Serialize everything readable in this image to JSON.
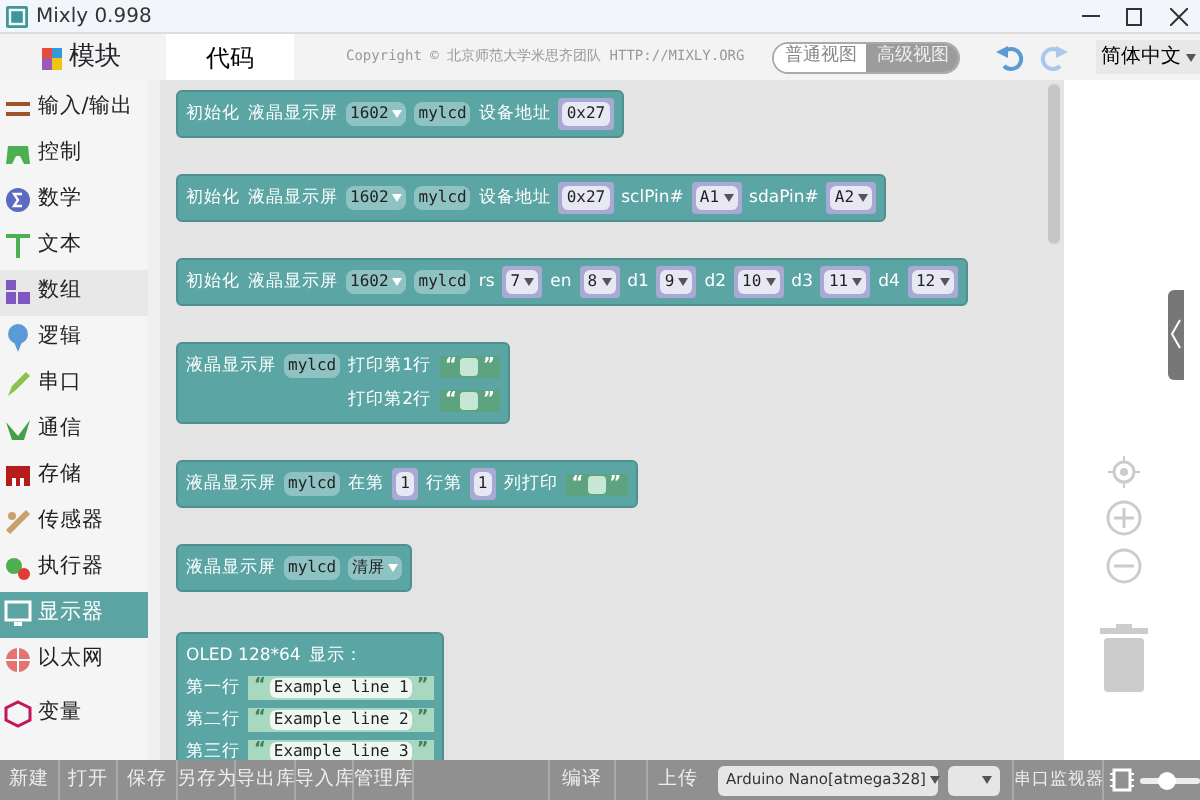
{
  "window": {
    "title": "Mixly 0.998"
  },
  "sidebar": {
    "header": "模块",
    "items": [
      {
        "label": "输入/输出",
        "selected": false,
        "hover": false
      },
      {
        "label": "控制",
        "selected": false,
        "hover": false
      },
      {
        "label": "数学",
        "selected": false,
        "hover": false
      },
      {
        "label": "文本",
        "selected": false,
        "hover": false
      },
      {
        "label": "数组",
        "selected": false,
        "hover": true
      },
      {
        "label": "逻辑",
        "selected": false,
        "hover": false
      },
      {
        "label": "串口",
        "selected": false,
        "hover": false
      },
      {
        "label": "通信",
        "selected": false,
        "hover": false
      },
      {
        "label": "存储",
        "selected": false,
        "hover": false
      },
      {
        "label": "传感器",
        "selected": false,
        "hover": false
      },
      {
        "label": "执行器",
        "selected": false,
        "hover": false
      },
      {
        "label": "显示器",
        "selected": true,
        "hover": false
      },
      {
        "label": "以太网",
        "selected": false,
        "hover": false
      },
      {
        "label": "变量",
        "selected": false,
        "hover": false
      }
    ]
  },
  "tabs": [
    {
      "label": "代码",
      "selected": true
    }
  ],
  "copyright": "Copyright © 北京师范大学米思齐团队 HTTP://MIXLY.ORG",
  "view_toggle": [
    {
      "label": "普通视图",
      "selected": false
    },
    {
      "label": "高级视图",
      "selected": true
    }
  ],
  "language": "简体中文",
  "blocks": [
    {
      "rows": [
        {
          "parts": [
            {
              "kind": "text",
              "text": "初始化"
            },
            {
              "kind": "text",
              "text": "液晶显示屏"
            },
            {
              "kind": "field",
              "text": "1602",
              "dropdown": true
            },
            {
              "kind": "field",
              "text": "mylcd",
              "dropdown": false
            },
            {
              "kind": "text",
              "text": "设备地址"
            },
            {
              "kind": "socket",
              "text": "0x27",
              "dropdown": false
            }
          ]
        }
      ]
    },
    {
      "rows": [
        {
          "parts": [
            {
              "kind": "text",
              "text": "初始化"
            },
            {
              "kind": "text",
              "text": "液晶显示屏"
            },
            {
              "kind": "field",
              "text": "1602",
              "dropdown": true
            },
            {
              "kind": "field",
              "text": "mylcd",
              "dropdown": false
            },
            {
              "kind": "text",
              "text": "设备地址"
            },
            {
              "kind": "socket",
              "text": "0x27",
              "dropdown": false
            },
            {
              "kind": "text",
              "text": "sclPin#"
            },
            {
              "kind": "socket",
              "text": "A1",
              "dropdown": true
            },
            {
              "kind": "text",
              "text": "sdaPin#"
            },
            {
              "kind": "socket",
              "text": "A2",
              "dropdown": true
            }
          ]
        }
      ]
    },
    {
      "rows": [
        {
          "parts": [
            {
              "kind": "text",
              "text": "初始化"
            },
            {
              "kind": "text",
              "text": "液晶显示屏"
            },
            {
              "kind": "field",
              "text": "1602",
              "dropdown": true
            },
            {
              "kind": "field",
              "text": "mylcd",
              "dropdown": false
            },
            {
              "kind": "text",
              "text": "rs"
            },
            {
              "kind": "socket",
              "text": "7",
              "dropdown": true
            },
            {
              "kind": "text",
              "text": "en"
            },
            {
              "kind": "socket",
              "text": "8",
              "dropdown": true
            },
            {
              "kind": "text",
              "text": "d1"
            },
            {
              "kind": "socket",
              "text": "9",
              "dropdown": true
            },
            {
              "kind": "text",
              "text": "d2"
            },
            {
              "kind": "socket",
              "text": "10",
              "dropdown": true
            },
            {
              "kind": "text",
              "text": "d3"
            },
            {
              "kind": "socket",
              "text": "11",
              "dropdown": true
            },
            {
              "kind": "text",
              "text": "d4"
            },
            {
              "kind": "socket",
              "text": "12",
              "dropdown": true
            }
          ]
        }
      ]
    },
    {
      "rows": [
        {
          "parts": [
            {
              "kind": "text",
              "text": "液晶显示屏"
            },
            {
              "kind": "field",
              "text": "mylcd",
              "dropdown": false
            },
            {
              "kind": "text",
              "text": "打印第1行"
            },
            {
              "kind": "string",
              "open": "“",
              "close": "”"
            }
          ]
        },
        {
          "parts": [
            {
              "kind": "text",
              "text": "打印第2行"
            },
            {
              "kind": "string",
              "open": "“",
              "close": "”"
            }
          ]
        }
      ]
    },
    {
      "rows": [
        {
          "parts": [
            {
              "kind": "text",
              "text": "液晶显示屏"
            },
            {
              "kind": "field",
              "text": "mylcd",
              "dropdown": false
            },
            {
              "kind": "text",
              "text": "在第"
            },
            {
              "kind": "socket",
              "text": "1",
              "dropdown": false
            },
            {
              "kind": "text",
              "text": "行第"
            },
            {
              "kind": "socket",
              "text": "1",
              "dropdown": false
            },
            {
              "kind": "text",
              "text": "列打印"
            },
            {
              "kind": "string",
              "open": "“",
              "close": "”"
            }
          ]
        }
      ]
    },
    {
      "rows": [
        {
          "parts": [
            {
              "kind": "text",
              "text": "液晶显示屏"
            },
            {
              "kind": "field",
              "text": "mylcd",
              "dropdown": false
            },
            {
              "kind": "field",
              "text": "清屏",
              "dropdown": true
            }
          ]
        }
      ]
    },
    {
      "rows": [
        {
          "parts": [
            {
              "kind": "text",
              "text": "OLED 128*64"
            },
            {
              "kind": "text",
              "text": "显示："
            }
          ]
        },
        {
          "parts": [
            {
              "kind": "text",
              "text": "第一行"
            },
            {
              "kind": "string",
              "open": "“",
              "text": "Example line 1",
              "close": "”"
            }
          ]
        },
        {
          "parts": [
            {
              "kind": "text",
              "text": "第二行"
            },
            {
              "kind": "string",
              "open": "“",
              "text": "Example line 2",
              "close": "”"
            }
          ]
        },
        {
          "parts": [
            {
              "kind": "text",
              "text": "第三行"
            },
            {
              "kind": "string",
              "open": "“",
              "text": "Example line 3",
              "close": "”"
            }
          ]
        }
      ]
    }
  ],
  "toolbar": {
    "buttons": [
      "新建",
      "打开",
      "保存",
      "另存为",
      "导出库",
      "导入库",
      "管理库"
    ],
    "compile": "编译",
    "upload": "上传",
    "board": "Arduino Nano[atmega328]",
    "serial_monitor": "串口监视器",
    "zoom_slider": {
      "level": 0.45
    }
  }
}
